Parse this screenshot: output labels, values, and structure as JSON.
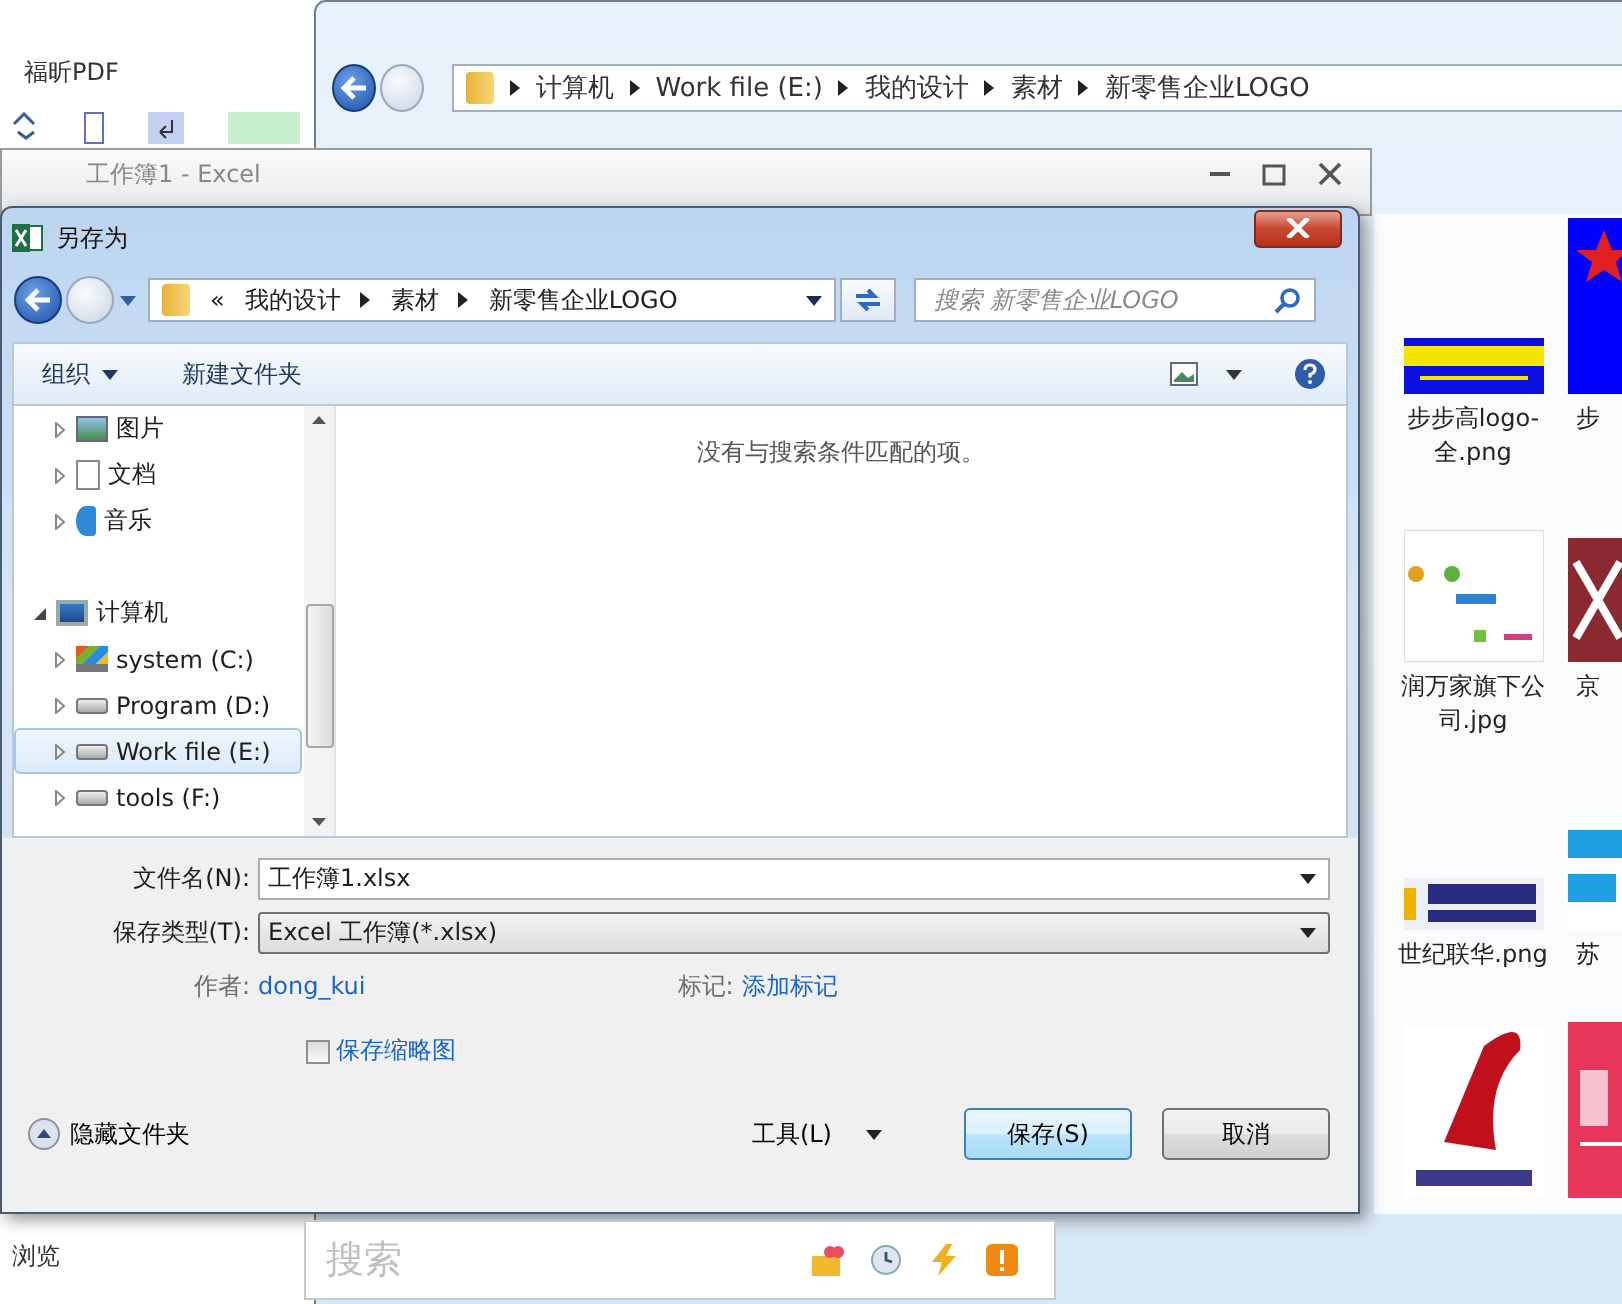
{
  "background_app": {
    "tab": "福昕PDF",
    "footer_label": "浏览"
  },
  "explorer": {
    "breadcrumb": [
      "计算机",
      "Work file (E:)",
      "我的设计",
      "素材",
      "新零售企业LOGO"
    ],
    "files": [
      {
        "name": "步步高logo-全.png",
        "kind": "picture"
      },
      {
        "name": "步",
        "kind": "picture"
      },
      {
        "name": "润万家旗下公司.jpg",
        "kind": "picture"
      },
      {
        "name": "京",
        "kind": "picture"
      },
      {
        "name": "世纪联华.png",
        "kind": "picture"
      },
      {
        "name": "苏",
        "kind": "picture"
      },
      {
        "kind": "picture"
      },
      {
        "kind": "picture"
      }
    ]
  },
  "excel_window": {
    "title": "工作簿1 - Excel"
  },
  "dialog": {
    "title": "另存为",
    "breadcrumb_prefix": "«",
    "breadcrumb": [
      "我的设计",
      "素材",
      "新零售企业LOGO"
    ],
    "search": {
      "placeholder": "搜索 新零售企业LOGO"
    },
    "toolbar": {
      "organize": "组织",
      "new_folder": "新建文件夹"
    },
    "tree": [
      {
        "label": "图片",
        "kind": "pictures",
        "expanded": false,
        "selected": false
      },
      {
        "label": "文档",
        "kind": "documents",
        "expanded": false,
        "selected": false
      },
      {
        "label": "音乐",
        "kind": "music",
        "expanded": false,
        "selected": false
      },
      {
        "label": "计算机",
        "kind": "computer",
        "expanded": true,
        "selected": false,
        "children": [
          {
            "label": "system (C:)",
            "kind": "system-drive",
            "expanded": false,
            "selected": false
          },
          {
            "label": "Program (D:)",
            "kind": "drive",
            "expanded": false,
            "selected": false
          },
          {
            "label": "Work file (E:)",
            "kind": "drive",
            "expanded": false,
            "selected": true
          },
          {
            "label": "tools (F:)",
            "kind": "drive",
            "expanded": false,
            "selected": false
          }
        ]
      }
    ],
    "empty_message": "没有与搜索条件匹配的项。",
    "file_name": {
      "label": "文件名(N):",
      "value": "工作簿1.xlsx"
    },
    "file_type": {
      "label": "保存类型(T):",
      "value": "Excel 工作簿(*.xlsx)"
    },
    "author": {
      "label": "作者:",
      "value": "dong_kui"
    },
    "tags": {
      "label": "标记:",
      "value": "添加标记"
    },
    "thumbnail": {
      "label": "保存缩略图",
      "checked": false
    },
    "hide_folders": "隐藏文件夹",
    "tools": "工具(L)",
    "save": "保存(S)",
    "cancel": "取消"
  },
  "search_bar": {
    "placeholder": "搜索"
  }
}
